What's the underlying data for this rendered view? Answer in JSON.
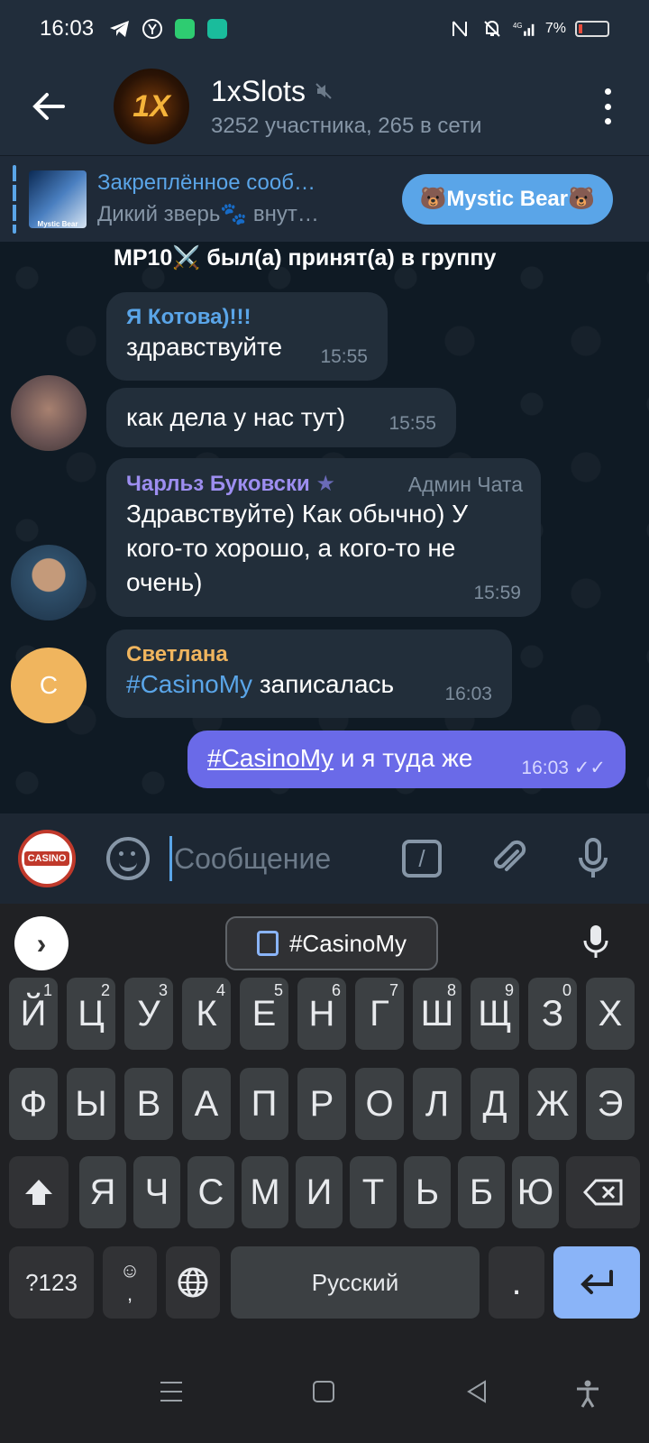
{
  "status": {
    "time": "16:03",
    "battery": "7%"
  },
  "header": {
    "title": "1xSlots",
    "avatar_text": "1X",
    "subtitle": "3252 участника, 265 в сети"
  },
  "pinned": {
    "title": "Закреплённое сооб…",
    "body": "Дикий зверь🐾 внут…",
    "button": "🐻Mystic Bear🐻",
    "thumb_text": "Mystic Bear"
  },
  "messages": {
    "service": "MP10⚔️ был(а) принят(а) в группу",
    "m1": {
      "sender": "Я Котова)!!!",
      "text": "здравствуйте",
      "time": "15:55",
      "sender_color": "#5aa5e8"
    },
    "m2": {
      "text": "как дела у нас тут)",
      "time": "15:55"
    },
    "m3": {
      "sender": "Чарльз Буковски",
      "badge": "★",
      "admin": "Админ Чата",
      "text": "Здравствуйте) Как обычно) У кого-то хорошо, а кого-то не очень)",
      "time": "15:59",
      "sender_color": "#9d8ef0"
    },
    "m4": {
      "sender": "Светлана",
      "avatar_letter": "С",
      "hashtag": "#CasinoMy",
      "text": " записалась",
      "time": "16:03",
      "sender_color": "#f0b55e"
    },
    "m5": {
      "hashtag": "#CasinoMy",
      "text": " и я туда же",
      "time": "16:03",
      "status": "✓✓"
    }
  },
  "composer": {
    "avatar_text": "CASINO",
    "placeholder": "Сообщение",
    "cmd_label": "/"
  },
  "keyboard": {
    "suggestion": "#CasinoMy",
    "row1": [
      {
        "k": "Й",
        "n": "1"
      },
      {
        "k": "Ц",
        "n": "2"
      },
      {
        "k": "У",
        "n": "3"
      },
      {
        "k": "К",
        "n": "4"
      },
      {
        "k": "Е",
        "n": "5"
      },
      {
        "k": "Н",
        "n": "6"
      },
      {
        "k": "Г",
        "n": "7"
      },
      {
        "k": "Ш",
        "n": "8"
      },
      {
        "k": "Щ",
        "n": "9"
      },
      {
        "k": "З",
        "n": "0"
      },
      {
        "k": "Х",
        "n": ""
      }
    ],
    "row2": [
      "Ф",
      "Ы",
      "В",
      "А",
      "П",
      "Р",
      "О",
      "Л",
      "Д",
      "Ж",
      "Э"
    ],
    "row3": [
      "Я",
      "Ч",
      "С",
      "М",
      "И",
      "Т",
      "Ь",
      "Б",
      "Ю"
    ],
    "symbols": "?123",
    "comma": ",",
    "emoji": "☺",
    "space": "Русский",
    "period": "."
  },
  "colors": {
    "accent": "#5aa5e8",
    "outgoing": "#6a6ae8",
    "header_bg": "#212d3b",
    "enter_key": "#8ab4f8"
  }
}
